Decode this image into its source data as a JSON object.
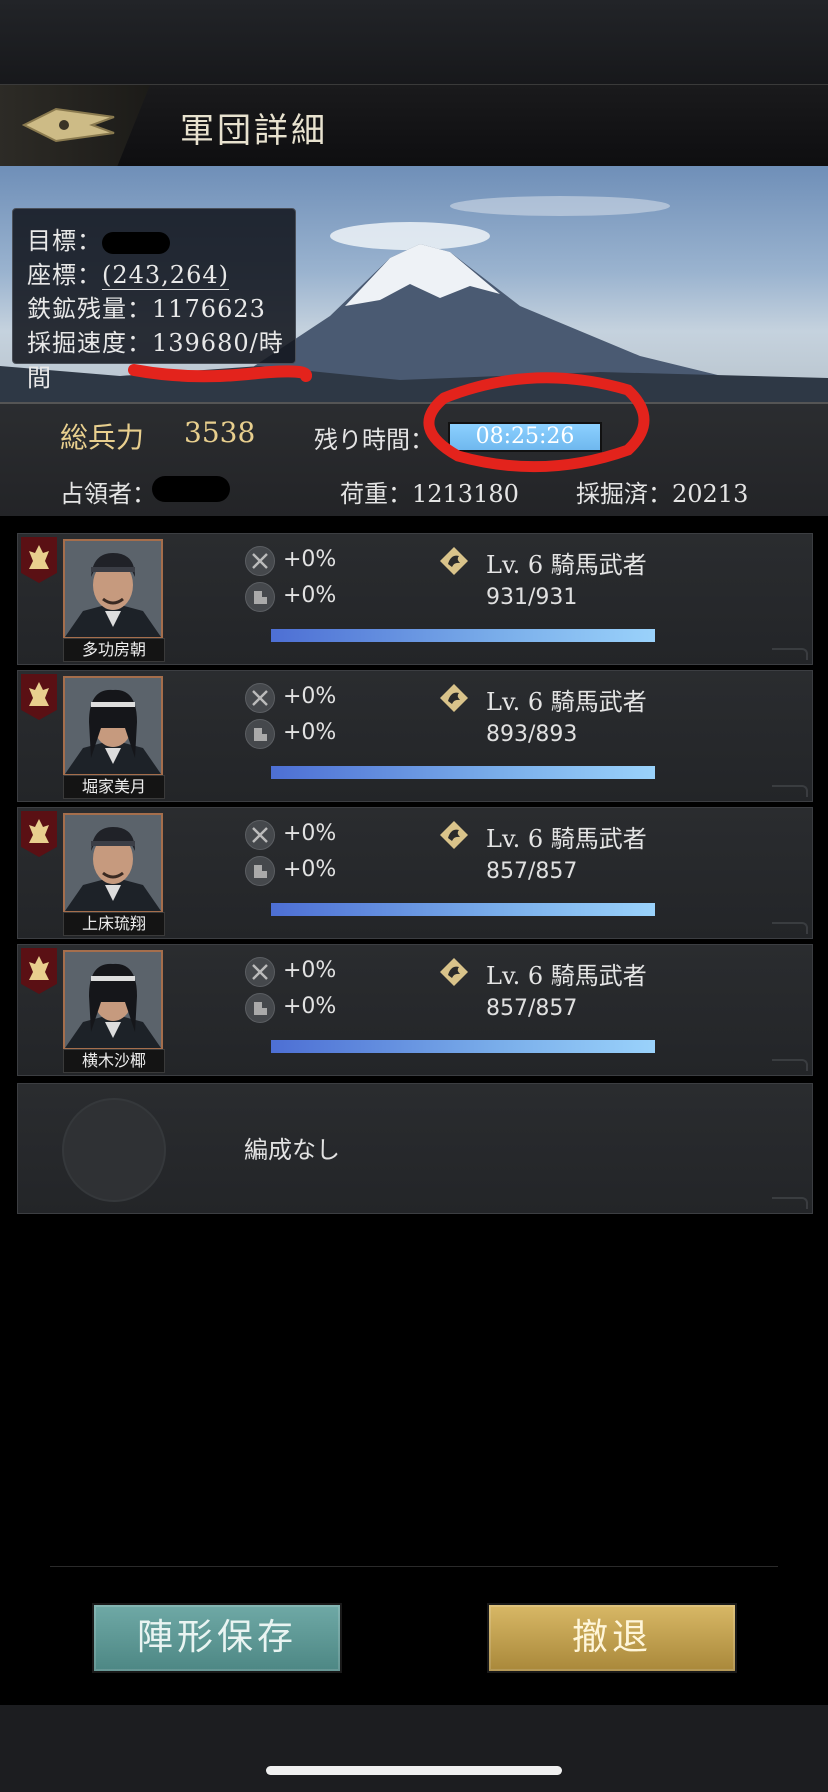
{
  "header": {
    "title": "軍団詳細"
  },
  "info": {
    "target_label": "目標：",
    "coords_label": "座標：",
    "coords_value": "(243,264)",
    "iron_label": "鉄鉱残量：",
    "iron_value": "1176623",
    "speed_label": "採掘速度：",
    "speed_value": "139680/時間"
  },
  "stats": {
    "troops_label": "総兵力",
    "troops_value": "3538",
    "remaining_label": "残り時間：",
    "remaining_value": "08:25:26",
    "occupant_label": "占領者：",
    "load_label": "荷重：",
    "load_value": "1213180",
    "mined_label": "採掘済：",
    "mined_value": "20213"
  },
  "generals": [
    {
      "name": "多功房朝",
      "atk": "+0%",
      "def": "+0%",
      "level": "Lv. 6 騎馬武者",
      "hp": "931/931",
      "hp_fraction": 1.0
    },
    {
      "name": "堀家美月",
      "atk": "+0%",
      "def": "+0%",
      "level": "Lv. 6 騎馬武者",
      "hp": "893/893",
      "hp_fraction": 1.0
    },
    {
      "name": "上床琉翔",
      "atk": "+0%",
      "def": "+0%",
      "level": "Lv. 6 騎馬武者",
      "hp": "857/857",
      "hp_fraction": 1.0
    },
    {
      "name": "横木沙椰",
      "atk": "+0%",
      "def": "+0%",
      "level": "Lv. 6 騎馬武者",
      "hp": "857/857",
      "hp_fraction": 1.0
    }
  ],
  "empty_slot": {
    "label": "編成なし"
  },
  "buttons": {
    "save": "陣形保存",
    "retreat": "撤退"
  },
  "colors": {
    "gold": "#e8cf8e",
    "bar": "#7aaeea",
    "retreat": "#c9a650",
    "save": "#5f9996"
  }
}
